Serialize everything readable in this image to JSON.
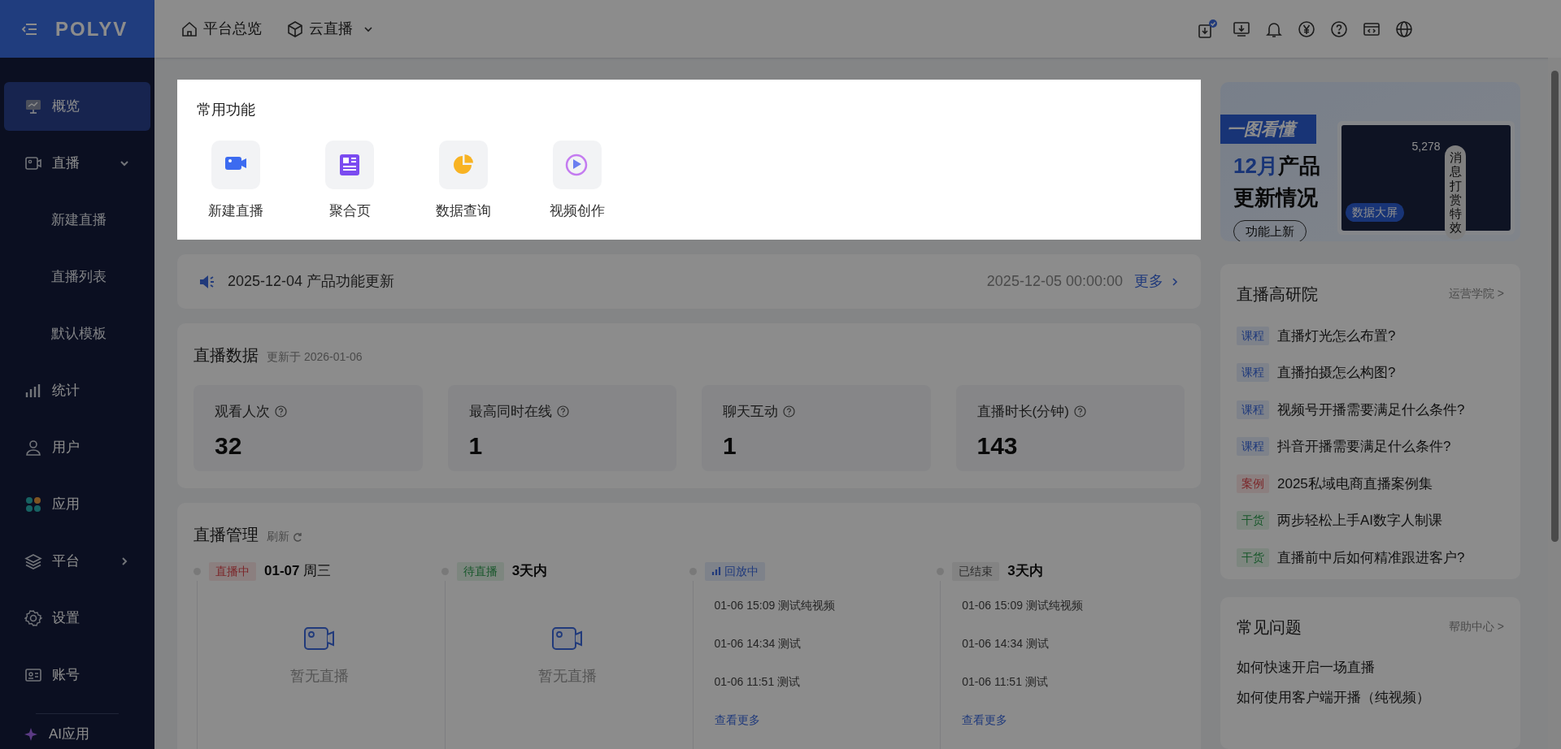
{
  "logo": "POLYV",
  "nav": [
    {
      "label": "平台总览",
      "dropdown": false
    },
    {
      "label": "云直播",
      "dropdown": true
    }
  ],
  "sidebar": {
    "items": [
      {
        "label": "概览",
        "selected": true
      },
      {
        "label": "直播",
        "selected": false,
        "expanded": true,
        "children": [
          {
            "label": "新建直播",
            "selected": false
          },
          {
            "label": "直播列表",
            "selected": false
          },
          {
            "label": "默认模板",
            "selected": false
          }
        ]
      },
      {
        "label": "统计",
        "selected": false
      },
      {
        "label": "用户",
        "selected": false
      },
      {
        "label": "应用",
        "selected": false
      },
      {
        "label": "平台",
        "selected": false,
        "expanded": false
      },
      {
        "label": "设置",
        "selected": false
      },
      {
        "label": "账号",
        "selected": false
      }
    ],
    "bottom_item": "AI应用"
  },
  "quick_actions": {
    "title": "常用功能",
    "items": [
      {
        "label": "新建直播"
      },
      {
        "label": "聚合页"
      },
      {
        "label": "数据查询"
      },
      {
        "label": "视频创作"
      }
    ]
  },
  "announcement": {
    "text": "2025-12-04 产品功能更新",
    "date": "2025-12-05 00:00:00",
    "more": "更多"
  },
  "live_data": {
    "title": "直播数据",
    "updated": "更新于 2026-01-06",
    "stats": [
      {
        "label": "观看人次",
        "value": "32"
      },
      {
        "label": "最高同时在线",
        "value": "1"
      },
      {
        "label": "聊天互动",
        "value": "1"
      },
      {
        "label": "直播时长(分钟)",
        "value": "143"
      }
    ]
  },
  "live_management": {
    "title": "直播管理",
    "refresh": "刷新",
    "columns": [
      {
        "kind": "empty",
        "tag": {
          "label": "直播中",
          "kind": "live"
        },
        "heading": "**01-07** 周三",
        "empty_text": "暂无直播"
      },
      {
        "kind": "empty",
        "tag": {
          "label": "待直播",
          "kind": "upcoming"
        },
        "heading": "**3天内**",
        "empty_text": "暂无直播"
      },
      {
        "kind": "list",
        "tag": {
          "label": "回放中",
          "kind": "replay"
        },
        "items": [
          "01-06 15:09 测试纯视频",
          "01-06 14:34 测试",
          "01-06 11:51 测试"
        ],
        "more": "查看更多"
      },
      {
        "kind": "list",
        "tag": {
          "label": "已结束",
          "kind": "ended"
        },
        "heading": "**3天内**",
        "items": [
          "01-06 15:09 测试纯视频",
          "01-06 14:34 测试",
          "01-06 11:51 测试"
        ],
        "more": "查看更多"
      }
    ]
  },
  "banner": {
    "ribbon": "一图看懂",
    "headline_accent": "12月",
    "headline": "产品",
    "subheadline": "更新情况",
    "button": "功能上新",
    "screen_value": "5,278",
    "callout": "消息打赏特效",
    "screen_badge": "数据大屏"
  },
  "academy": {
    "title": "直播高研院",
    "link": "运营学院 >",
    "items": [
      {
        "tag": "课程",
        "kind": "course",
        "text": "直播灯光怎么布置?"
      },
      {
        "tag": "课程",
        "kind": "course",
        "text": "直播拍摄怎么构图?"
      },
      {
        "tag": "课程",
        "kind": "course",
        "text": "视频号开播需要满足什么条件?"
      },
      {
        "tag": "课程",
        "kind": "course",
        "text": "抖音开播需要满足什么条件?"
      },
      {
        "tag": "案例",
        "kind": "case",
        "text": "2025私域电商直播案例集"
      },
      {
        "tag": "干货",
        "kind": "tips",
        "text": "两步轻松上手AI数字人制课"
      },
      {
        "tag": "干货",
        "kind": "tips",
        "text": "直播前中后如何精准跟进客户?"
      }
    ]
  },
  "faq": {
    "title": "常见问题",
    "link": "帮助中心 >",
    "items": [
      "如何快速开启一场直播",
      "如何使用客户端开播（纯视频）"
    ]
  }
}
